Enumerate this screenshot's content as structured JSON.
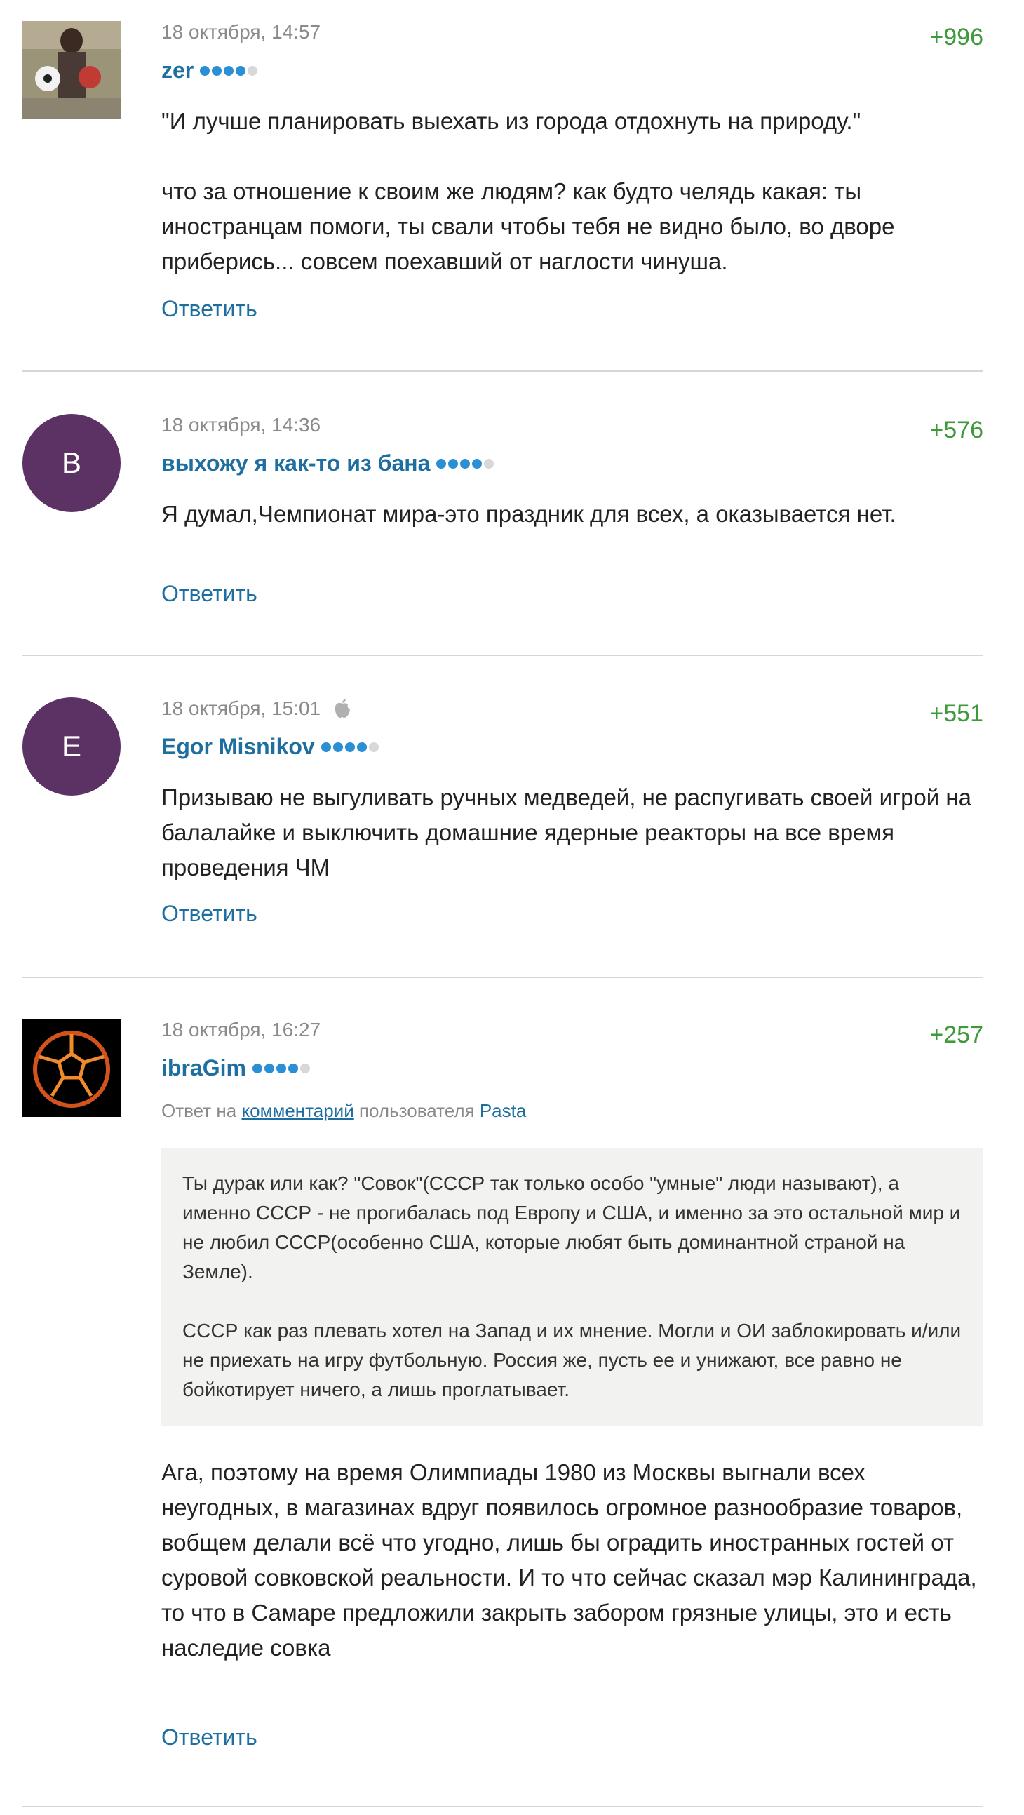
{
  "comments": [
    {
      "date": "18 октября, 14:57",
      "score": "+996",
      "author": "zer",
      "text1": "\"И лучше планировать выехать из города отдохнуть на природу.\"",
      "text2": "что за отношение к своим же людям? как будто челядь какая: ты иностранцам помоги, ты свали чтобы тебя не видно было, во дворе приберись... совсем поехавший от наглости чинуша.",
      "reply": "Ответить"
    },
    {
      "avatar_letter": "В",
      "date": "18 октября, 14:36",
      "score": "+576",
      "author": "выхожу я как-то из бана",
      "text1": "Я думал,Чемпионат мира-это праздник для всех, а оказывается нет.",
      "reply": "Ответить"
    },
    {
      "avatar_letter": "E",
      "date": "18 октября, 15:01",
      "device_icon": "apple-icon",
      "score": "+551",
      "author": "Egor Misnikov",
      "text1": "Призываю не выгуливать ручных медведей, не распугивать своей игрой на балалайке и выключить домашние ядерные реакторы на все время проведения ЧМ",
      "reply": "Ответить"
    },
    {
      "date": "18 октября, 16:27",
      "score": "+257",
      "author": "ibraGim",
      "reply_to_prefix": "Ответ на",
      "reply_to_link": "комментарий",
      "reply_to_middle": "пользователя",
      "reply_to_user": "Pasta",
      "quote1": "Ты дурак или как? \"Совок\"(СССР так только особо \"умные\" люди называют), а именно СССР - не прогибалась под Европу и США, и именно за это остальной мир и не любил СССР(особенно США, которые любят быть доминантной страной на Земле).",
      "quote2": "СССР как раз плевать хотел на Запад и их мнение. Могли и ОИ заблокировать и/или не приехать на игру футбольную. Россия же, пусть ее и унижают, все равно не бойкотирует ничего, а лишь проглатывает.",
      "text1": "Ага, поэтому на время Олимпиады 1980 из Москвы выгнали всех неугодных, в магазинах вдруг появилось огромное разнообразие товаров, вобщем делали всё что угодно, лишь бы оградить иностранных гостей от суровой совковской реальности. И то что сейчас сказал мэр Калининграда, то что в Самаре предложили закрыть забором грязные улицы, это и есть наследие совка",
      "reply": "Ответить"
    }
  ],
  "colors": {
    "author": "#1e6fa0",
    "score": "#3e9a3a",
    "avatar_bg": "#5c3163",
    "rating_dot_on": "#2b8fd6",
    "rating_dot_off": "#d8d8d8"
  }
}
